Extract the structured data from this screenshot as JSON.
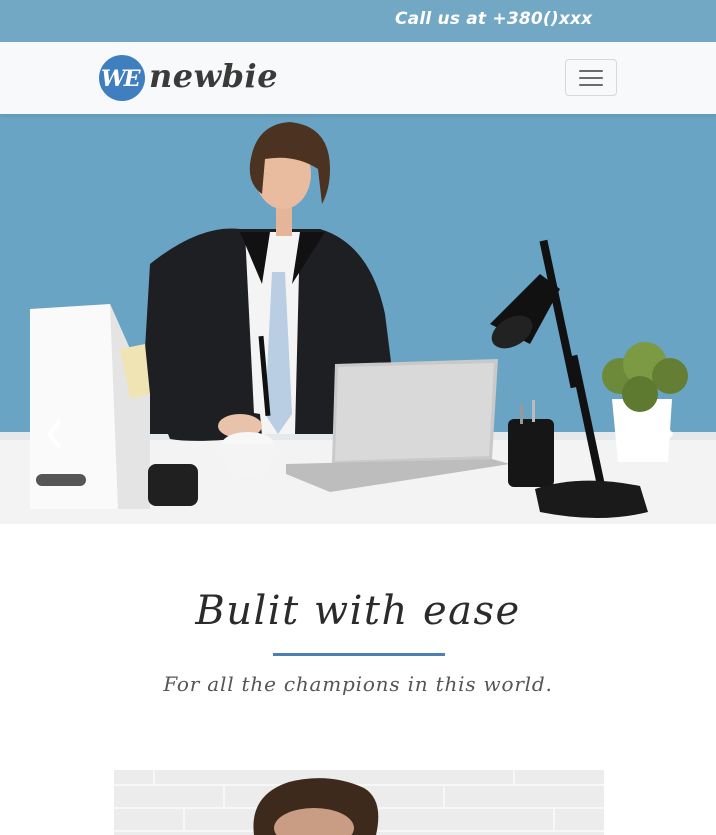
{
  "topbar": {
    "call_text": "Call us at +380()xxx"
  },
  "navbar": {
    "logo_mark": "WE",
    "logo_text": "newbie",
    "toggler_icon": "hamburger-menu-icon"
  },
  "carousel": {
    "prev_icon": "chevron-left-icon",
    "next_icon": "chevron-right-icon"
  },
  "intro": {
    "headline": "Bulit with ease",
    "subheadline": "For all the champions in this world."
  },
  "colors": {
    "topbar_bg": "#73a8c4",
    "accent": "#4a80b8",
    "logo_blue": "#3f7fc0",
    "hero_bg": "#6aa4c4"
  }
}
